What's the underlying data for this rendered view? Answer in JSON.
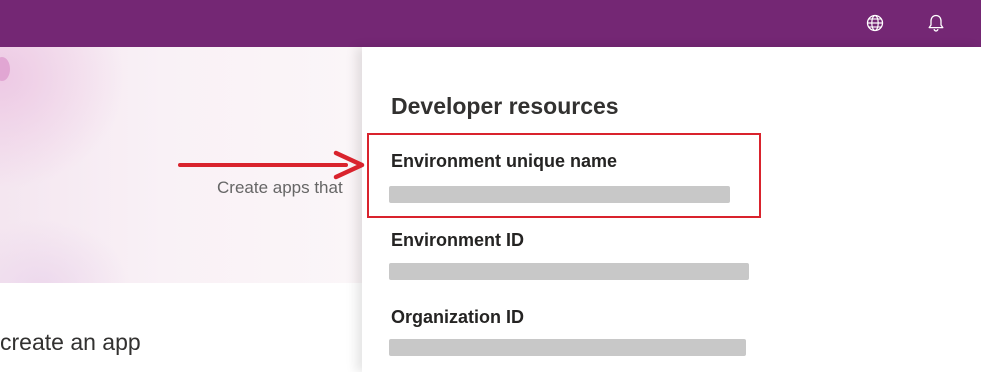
{
  "header": {
    "background": "#742774",
    "globe_icon": "globe-icon",
    "bell_icon": "bell-icon"
  },
  "hero": {
    "text": "Create apps that",
    "create_app_heading": "create an app"
  },
  "panel": {
    "title": "Developer resources",
    "fields": [
      {
        "label": "Environment unique name",
        "value_redacted": true
      },
      {
        "label": "Environment ID",
        "value_redacted": true
      },
      {
        "label": "Organization ID",
        "value_redacted": true
      }
    ]
  },
  "annotation": {
    "highlight_color": "#d9232d",
    "arrow_icon": "right-arrow-icon"
  }
}
